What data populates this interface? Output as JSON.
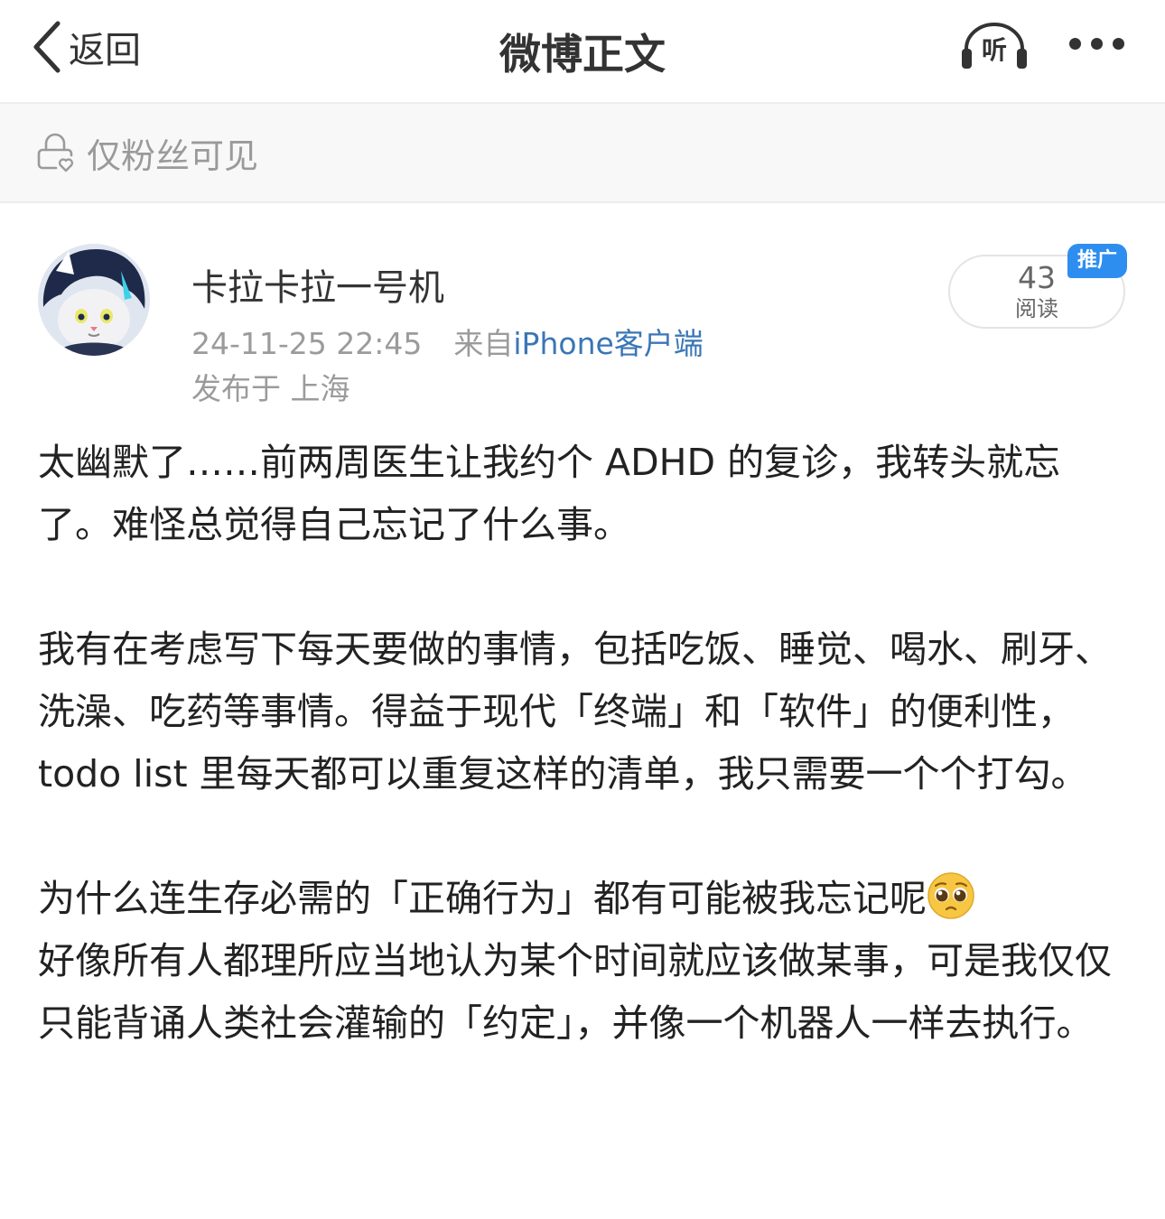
{
  "topbar": {
    "back_label": "返回",
    "title": "微博正文",
    "listen_label": "听"
  },
  "visibility": {
    "text": "仅粉丝可见"
  },
  "author": {
    "name": "卡拉卡拉一号机",
    "timestamp": "24-11-25 22:45",
    "source_prefix": "来自",
    "source": "iPhone客户端",
    "location": "发布于 上海"
  },
  "stats": {
    "read_count": "43",
    "read_label": "阅读",
    "promo_badge": "推广"
  },
  "post": {
    "paragraph1": "太幽默了……前两周医生让我约个 ADHD 的复诊，我转头就忘了。难怪总觉得自己忘记了什么事。",
    "paragraph2": "我有在考虑写下每天要做的事情，包括吃饭、睡觉、喝水、刷牙、洗澡、吃药等事情。得益于现代「终端」和「软件」的便利性，todo list 里每天都可以重复这样的清单，我只需要一个个打勾。",
    "paragraph3_a": "为什么连生存必需的「正确行为」都有可能被我忘记呢",
    "paragraph3_b": "好像所有人都理所应当地认为某个时间就应该做某事，可是我仅仅只能背诵人类社会灌输的「约定」，并像一个机器人一样去执行。",
    "emoji": "pleading-face-emoji"
  },
  "colors": {
    "link": "#3a76b6",
    "badge": "#2e8ef0",
    "muted_text": "#9b9b9b"
  }
}
